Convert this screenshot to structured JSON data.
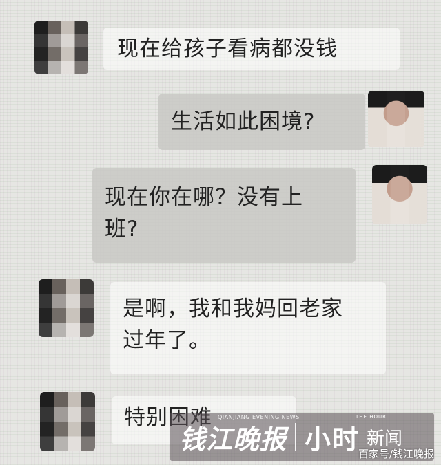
{
  "messages": [
    {
      "side": "left",
      "text": "现在给孩子看病都没钱"
    },
    {
      "side": "right",
      "text": "生活如此困境?"
    },
    {
      "side": "right",
      "text": "现在你在哪？没有上班?"
    },
    {
      "side": "left",
      "text": "是啊，我和我妈回老家过年了。"
    },
    {
      "side": "left",
      "text": "特别困难"
    }
  ],
  "msg_lines": {
    "m1_l1": "现在给孩子看病都没钱",
    "m2_l1": "生活如此困境?",
    "m3_l1": "现在你在哪？没有上",
    "m3_l2": "班?",
    "m4_l1": "是啊，我和我妈回老家",
    "m4_l2": "过年了。",
    "m5_l1": "特别困难"
  },
  "watermark": {
    "paper_name": "钱江晚报",
    "paper_name_en": "QIANJIANG EVENING NEWS",
    "brand": "小时",
    "brand_sub": "THE HOUR",
    "news": "新闻",
    "source": "百家号/钱江晚报"
  }
}
